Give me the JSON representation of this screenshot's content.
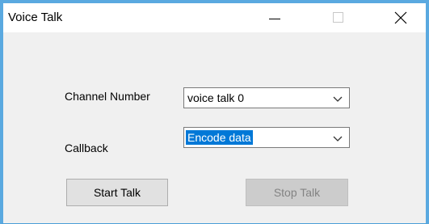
{
  "window": {
    "title": "Voice Talk"
  },
  "form": {
    "channel_label": "Channel Number",
    "channel_value": "voice talk 0",
    "callback_label": "Callback",
    "callback_value": "Encode data",
    "start_button": "Start Talk",
    "stop_button": "Stop Talk"
  },
  "icons": {
    "minimize": "minimize-icon",
    "maximize": "maximize-icon",
    "close": "close-icon",
    "dropdown": "chevron-down-icon"
  },
  "colors": {
    "selection": "#0078d7",
    "frame": "#5aa9e0"
  }
}
